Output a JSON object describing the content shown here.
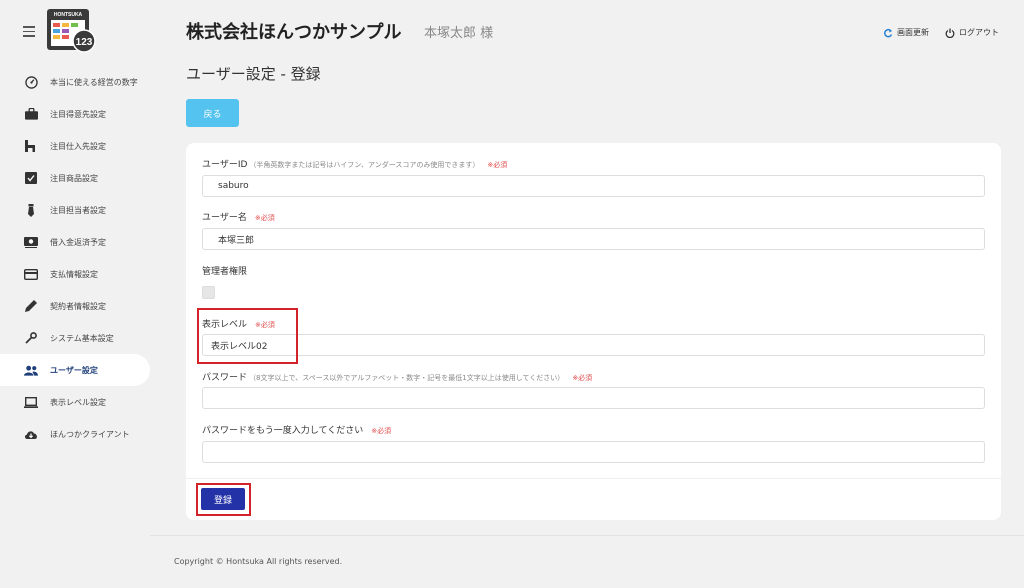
{
  "logo": {
    "text": "HONTSUKA",
    "number": "123"
  },
  "sidebar": {
    "items": [
      {
        "label": "本当に使える経営の数字",
        "icon": "dashboard-icon"
      },
      {
        "label": "注目得意先設定",
        "icon": "briefcase-icon"
      },
      {
        "label": "注目仕入先設定",
        "icon": "hotel-icon"
      },
      {
        "label": "注目商品設定",
        "icon": "checkbox-icon"
      },
      {
        "label": "注目担当者設定",
        "icon": "tie-icon"
      },
      {
        "label": "借入金返済予定",
        "icon": "money-icon"
      },
      {
        "label": "支払情報設定",
        "icon": "card-icon"
      },
      {
        "label": "契約者情報設定",
        "icon": "pen-icon"
      },
      {
        "label": "システム基本設定",
        "icon": "wrench-icon"
      },
      {
        "label": "ユーザー設定",
        "icon": "users-icon",
        "active": true
      },
      {
        "label": "表示レベル設定",
        "icon": "laptop-icon"
      },
      {
        "label": "ほんつかクライアント",
        "icon": "cloud-download-icon"
      }
    ]
  },
  "header": {
    "company": "株式会社ほんつかサンプル",
    "user": "本塚太郎 様",
    "refresh": "画面更新",
    "logout": "ログアウト"
  },
  "page": {
    "title": "ユーザー設定 - 登録",
    "back": "戻る"
  },
  "form": {
    "required": "※必須",
    "user_id": {
      "label": "ユーザーID",
      "note": "（半角英数字または記号はハイフン、アンダースコアのみ使用できます）",
      "value": "saburo"
    },
    "user_name": {
      "label": "ユーザー名",
      "value": "本塚三郎"
    },
    "admin": {
      "label": "管理者権限"
    },
    "display_level": {
      "label": "表示レベル",
      "value": "表示レベル02"
    },
    "password": {
      "label": "パスワード",
      "note": "（8文字以上で、スペース以外でアルファベット・数字・記号を最低1文字以上は使用してください）",
      "value": ""
    },
    "password_confirm": {
      "label": "パスワードをもう一度入力してください",
      "value": ""
    },
    "submit": "登録"
  },
  "footer": {
    "copyright": "Copyright © Hontsuka All rights reserved."
  },
  "colors": {
    "accent": "#55c3ef",
    "primary": "#2432a8",
    "highlight": "#d2232a",
    "required": "#e04b4b",
    "active_nav": "#1f3f7a"
  }
}
